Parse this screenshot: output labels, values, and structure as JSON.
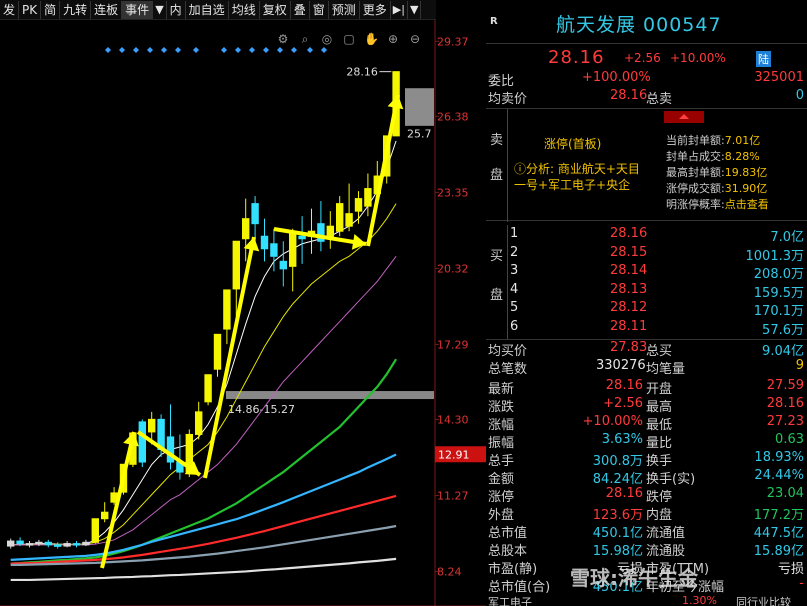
{
  "toolbar": {
    "items": [
      "发",
      "PK",
      "简",
      "九转",
      "连板",
      "事件",
      "▼",
      "内",
      "加自选",
      "均线",
      "复权",
      "叠",
      "窗",
      "预测",
      "更多",
      "▶|",
      "▼"
    ]
  },
  "chart_tools": [
    "⚙",
    "⌕",
    "◎",
    "▢",
    "✋",
    "⊕",
    "⊖"
  ],
  "chart_data": {
    "type": "candlestick",
    "y_ticks": [
      "29.37",
      "26.38",
      "23.35",
      "20.32",
      "17.29",
      "14.30",
      "11.27",
      "8.24"
    ],
    "y_tick_values": [
      29.37,
      26.38,
      23.35,
      20.32,
      17.29,
      14.3,
      11.27,
      8.24
    ],
    "current_price_label": "12.91",
    "current_price_value": 12.91,
    "ylim": [
      7.3,
      29.9
    ],
    "annotations": {
      "high_label": "28.16",
      "high_value": 28.16,
      "low_right_label": "25.7",
      "low_right_value": 25.7,
      "range_label": "14.86-15.27",
      "range_value": 15.27
    },
    "candles": [
      {
        "o": 9.25,
        "c": 9.45,
        "h": 9.55,
        "l": 9.15
      },
      {
        "o": 9.45,
        "c": 9.35,
        "h": 9.6,
        "l": 9.25
      },
      {
        "o": 9.3,
        "c": 9.35,
        "h": 9.45,
        "l": 9.2
      },
      {
        "o": 9.35,
        "c": 9.4,
        "h": 9.5,
        "l": 9.25
      },
      {
        "o": 9.4,
        "c": 9.3,
        "h": 9.5,
        "l": 9.2
      },
      {
        "o": 9.3,
        "c": 9.25,
        "h": 9.4,
        "l": 9.15
      },
      {
        "o": 9.25,
        "c": 9.35,
        "h": 9.45,
        "l": 9.2
      },
      {
        "o": 9.35,
        "c": 9.3,
        "h": 9.45,
        "l": 9.2
      },
      {
        "o": 9.3,
        "c": 9.4,
        "h": 9.5,
        "l": 9.25
      },
      {
        "o": 9.4,
        "c": 10.34,
        "h": 10.34,
        "l": 9.35
      },
      {
        "o": 10.34,
        "c": 10.6,
        "h": 11.0,
        "l": 10.2
      },
      {
        "o": 11.0,
        "c": 11.37,
        "h": 11.6,
        "l": 10.9
      },
      {
        "o": 11.4,
        "c": 12.51,
        "h": 12.51,
        "l": 11.3
      },
      {
        "o": 12.51,
        "c": 13.76,
        "h": 13.76,
        "l": 12.4
      },
      {
        "o": 14.2,
        "c": 12.6,
        "h": 14.3,
        "l": 12.4
      },
      {
        "o": 13.8,
        "c": 14.3,
        "h": 14.6,
        "l": 13.3
      },
      {
        "o": 14.3,
        "c": 13.1,
        "h": 14.5,
        "l": 12.8
      },
      {
        "o": 13.6,
        "c": 12.6,
        "h": 14.9,
        "l": 12.3
      },
      {
        "o": 12.6,
        "c": 12.2,
        "h": 13.7,
        "l": 11.9
      },
      {
        "o": 12.2,
        "c": 13.7,
        "h": 13.9,
        "l": 12.0
      },
      {
        "o": 13.7,
        "c": 14.6,
        "h": 15.0,
        "l": 13.5
      },
      {
        "o": 15.0,
        "c": 16.08,
        "h": 16.08,
        "l": 14.86
      },
      {
        "o": 16.3,
        "c": 17.69,
        "h": 17.69,
        "l": 16.0
      },
      {
        "o": 17.9,
        "c": 19.46,
        "h": 19.46,
        "l": 17.3
      },
      {
        "o": 19.5,
        "c": 21.4,
        "h": 21.4,
        "l": 18.4
      },
      {
        "o": 21.5,
        "c": 22.3,
        "h": 23.1,
        "l": 20.6
      },
      {
        "o": 22.9,
        "c": 22.1,
        "h": 23.2,
        "l": 21.3
      },
      {
        "o": 21.6,
        "c": 21.1,
        "h": 22.3,
        "l": 20.6
      },
      {
        "o": 21.3,
        "c": 20.8,
        "h": 21.9,
        "l": 20.2
      },
      {
        "o": 20.6,
        "c": 20.3,
        "h": 21.4,
        "l": 19.6
      },
      {
        "o": 20.4,
        "c": 21.7,
        "h": 21.9,
        "l": 19.4
      },
      {
        "o": 21.6,
        "c": 21.5,
        "h": 22.4,
        "l": 20.5
      },
      {
        "o": 21.6,
        "c": 21.8,
        "h": 22.7,
        "l": 20.9
      },
      {
        "o": 22.1,
        "c": 21.4,
        "h": 23.0,
        "l": 21.0
      },
      {
        "o": 21.6,
        "c": 22.0,
        "h": 22.6,
        "l": 21.1
      },
      {
        "o": 21.8,
        "c": 22.9,
        "h": 23.2,
        "l": 21.6
      },
      {
        "o": 22.0,
        "c": 22.5,
        "h": 23.7,
        "l": 21.8
      },
      {
        "o": 22.6,
        "c": 23.1,
        "h": 23.4,
        "l": 22.1
      },
      {
        "o": 22.8,
        "c": 23.5,
        "h": 24.1,
        "l": 22.4
      },
      {
        "o": 23.3,
        "c": 24.0,
        "h": 24.6,
        "l": 23.0
      },
      {
        "o": 24.0,
        "c": 25.6,
        "h": 25.6,
        "l": 23.7
      },
      {
        "o": 25.6,
        "c": 28.16,
        "h": 28.16,
        "l": 25.6
      }
    ],
    "ma_series": [
      {
        "color": "#ffffff",
        "values": [
          9.3,
          9.32,
          9.33,
          9.35,
          9.35,
          9.33,
          9.32,
          9.32,
          9.33,
          9.5,
          9.8,
          10.2,
          10.7,
          11.3,
          11.9,
          12.5,
          12.9,
          13.1,
          13.2,
          13.3,
          13.6,
          14.1,
          14.8,
          15.7,
          16.9,
          18.1,
          19.2,
          20.0,
          20.6,
          20.9,
          21.1,
          21.3,
          21.4,
          21.5,
          21.6,
          21.8,
          22.0,
          22.3,
          22.8,
          23.4,
          24.3,
          25.4
        ]
      },
      {
        "color": "#e5e500",
        "values": [
          9.3,
          9.3,
          9.31,
          9.32,
          9.32,
          9.32,
          9.32,
          9.32,
          9.33,
          9.4,
          9.55,
          9.8,
          10.1,
          10.5,
          10.9,
          11.3,
          11.7,
          12.1,
          12.4,
          12.7,
          13.0,
          13.3,
          13.8,
          14.4,
          15.1,
          15.8,
          16.5,
          17.2,
          17.8,
          18.4,
          18.9,
          19.3,
          19.7,
          20.0,
          20.3,
          20.6,
          20.8,
          21.1,
          21.4,
          21.8,
          22.3,
          22.9
        ]
      },
      {
        "color": "#c060c0",
        "values": [
          9.3,
          9.3,
          9.3,
          9.3,
          9.3,
          9.3,
          9.3,
          9.3,
          9.3,
          9.33,
          9.4,
          9.5,
          9.7,
          9.9,
          10.2,
          10.5,
          10.8,
          11.1,
          11.3,
          11.6,
          11.9,
          12.2,
          12.5,
          12.9,
          13.3,
          13.8,
          14.3,
          14.8,
          15.3,
          15.8,
          16.2,
          16.6,
          17.0,
          17.4,
          17.8,
          18.2,
          18.6,
          19.0,
          19.4,
          19.8,
          20.3,
          20.8
        ]
      },
      {
        "color": "#22c22e",
        "values": [
          8.55,
          8.57,
          8.6,
          8.62,
          8.65,
          8.68,
          8.7,
          8.73,
          8.76,
          8.8,
          8.86,
          8.95,
          9.05,
          9.17,
          9.3,
          9.45,
          9.6,
          9.75,
          9.9,
          10.05,
          10.2,
          10.35,
          10.55,
          10.75,
          10.95,
          11.2,
          11.45,
          11.7,
          11.95,
          12.2,
          12.5,
          12.8,
          13.1,
          13.4,
          13.7,
          14.0,
          14.4,
          14.8,
          15.2,
          15.6,
          16.1,
          16.7
        ]
      },
      {
        "color": "#33b5ff",
        "values": [
          8.7,
          8.72,
          8.74,
          8.76,
          8.78,
          8.8,
          8.82,
          8.84,
          8.86,
          8.9,
          8.95,
          9.02,
          9.1,
          9.2,
          9.3,
          9.42,
          9.52,
          9.62,
          9.72,
          9.82,
          9.92,
          10.02,
          10.12,
          10.22,
          10.32,
          10.45,
          10.58,
          10.72,
          10.86,
          11.0,
          11.15,
          11.3,
          11.45,
          11.6,
          11.75,
          11.9,
          12.05,
          12.2,
          12.38,
          12.55,
          12.72,
          12.9
        ]
      },
      {
        "color": "#ff2a2a",
        "values": [
          8.55,
          8.56,
          8.57,
          8.58,
          8.6,
          8.62,
          8.64,
          8.66,
          8.68,
          8.7,
          8.73,
          8.76,
          8.8,
          8.85,
          8.9,
          8.96,
          9.02,
          9.08,
          9.14,
          9.2,
          9.27,
          9.34,
          9.42,
          9.5,
          9.58,
          9.67,
          9.76,
          9.85,
          9.95,
          10.05,
          10.15,
          10.25,
          10.35,
          10.45,
          10.55,
          10.65,
          10.75,
          10.85,
          10.95,
          11.05,
          11.15,
          11.25
        ]
      },
      {
        "color": "#8aa0b0",
        "values": [
          8.5,
          8.5,
          8.51,
          8.52,
          8.53,
          8.54,
          8.55,
          8.56,
          8.57,
          8.58,
          8.6,
          8.62,
          8.64,
          8.66,
          8.68,
          8.71,
          8.74,
          8.77,
          8.8,
          8.83,
          8.87,
          8.91,
          8.95,
          9.0,
          9.05,
          9.1,
          9.15,
          9.2,
          9.26,
          9.32,
          9.38,
          9.44,
          9.5,
          9.56,
          9.62,
          9.68,
          9.74,
          9.8,
          9.86,
          9.92,
          9.98,
          10.05
        ]
      },
      {
        "color": "#e0e0e0",
        "values": [
          7.9,
          7.9,
          7.9,
          7.91,
          7.92,
          7.93,
          7.94,
          7.95,
          7.96,
          7.97,
          7.98,
          8.0,
          8.01,
          8.02,
          8.04,
          8.05,
          8.07,
          8.09,
          8.1,
          8.12,
          8.14,
          8.16,
          8.18,
          8.2,
          8.22,
          8.24,
          8.27,
          8.3,
          8.32,
          8.35,
          8.38,
          8.41,
          8.44,
          8.47,
          8.5,
          8.53,
          8.56,
          8.6,
          8.63,
          8.66,
          8.7,
          8.74
        ]
      }
    ]
  },
  "quote": {
    "r_mark": "R",
    "title": "航天发展 000547",
    "price": "28.16",
    "change": "+2.56",
    "change_pct": "+10.00%",
    "badge": "陆",
    "weibi_label": "委比",
    "weibi_value": "+100.00%",
    "weibi_diff": "325001",
    "junmai_label": "均卖价",
    "junmai_value": "28.16",
    "zongmai_label": "总卖",
    "zongmai_value": "0",
    "sell_side": [
      "卖",
      "盘"
    ],
    "limit_title": "涨停(首板)",
    "limit_analysis": "ⓘ分析: 商业航天+天目一号+军工电子+央企",
    "limit_stats": [
      {
        "label": "当前封单额:",
        "value": "7.01亿"
      },
      {
        "label": "封单占成交:",
        "value": "8.28%"
      },
      {
        "label": "最高封单额:",
        "value": "19.83亿"
      },
      {
        "label": "涨停成交额:",
        "value": "31.90亿"
      },
      {
        "label": "明涨停概率:",
        "value": "点击查看"
      }
    ],
    "buy_side": [
      "买",
      "盘"
    ],
    "buy_levels": [
      {
        "n": "1",
        "p": "28.16",
        "v": "7.0亿"
      },
      {
        "n": "2",
        "p": "28.15",
        "v": "1001.3万"
      },
      {
        "n": "3",
        "p": "28.14",
        "v": "208.0万"
      },
      {
        "n": "4",
        "p": "28.13",
        "v": "159.5万"
      },
      {
        "n": "5",
        "p": "28.12",
        "v": "170.1万"
      },
      {
        "n": "6",
        "p": "28.11",
        "v": "57.6万"
      }
    ],
    "junmai2_label": "均买价",
    "junmai2_value": "27.83",
    "zongmai2_label": "总买",
    "zongmai2_value": "9.04亿",
    "zongbi_label": "总笔数",
    "zongbi_value": "330276",
    "junbi_label": "均笔量",
    "junbi_value": "9",
    "stats": [
      {
        "l1": "最新",
        "v1": "28.16",
        "c1": "red",
        "l2": "开盘",
        "v2": "27.59",
        "c2": "red"
      },
      {
        "l1": "涨跌",
        "v1": "+2.56",
        "c1": "red",
        "l2": "最高",
        "v2": "28.16",
        "c2": "red"
      },
      {
        "l1": "涨幅",
        "v1": "+10.00%",
        "c1": "red",
        "l2": "最低",
        "v2": "27.23",
        "c2": "red"
      },
      {
        "l1": "振幅",
        "v1": "3.63%",
        "c1": "cyn",
        "l2": "量比",
        "v2": "0.63",
        "c2": "grn"
      },
      {
        "l1": "总手",
        "v1": "300.8万",
        "c1": "cyn",
        "l2": "换手",
        "v2": "18.93%",
        "c2": "cyn"
      },
      {
        "l1": "金额",
        "v1": "84.24亿",
        "c1": "cyn",
        "l2": "换手(实)",
        "v2": "24.44%",
        "c2": "cyn"
      },
      {
        "l1": "涨停",
        "v1": "28.16",
        "c1": "red",
        "l2": "跌停",
        "v2": "23.04",
        "c2": "grn"
      },
      {
        "l1": "外盘",
        "v1": "123.6万",
        "c1": "red",
        "l2": "内盘",
        "v2": "177.2万",
        "c2": "grn"
      },
      {
        "l1": "总市值",
        "v1": "450.1亿",
        "c1": "cyn",
        "l2": "流通值",
        "v2": "447.5亿",
        "c2": "cyn"
      },
      {
        "l1": "总股本",
        "v1": "15.98亿",
        "c1": "cyn",
        "l2": "流通股",
        "v2": "15.89亿",
        "c2": "cyn"
      },
      {
        "l1": "市盈(静)",
        "v1": "亏损",
        "c1": "wht",
        "l2": "市盈(TTM)",
        "v2": "亏损",
        "c2": "wht"
      },
      {
        "l1": "总市值(合)",
        "v1": "450.1亿",
        "c1": "cyn",
        "l2": "年初至今涨幅",
        "v2": "-",
        "c2": "red"
      }
    ],
    "footer_left": "军工电子",
    "footer_mid": "1.30%",
    "footer_right": "同行业比较",
    "watermark": "雪球:浠午生金"
  }
}
